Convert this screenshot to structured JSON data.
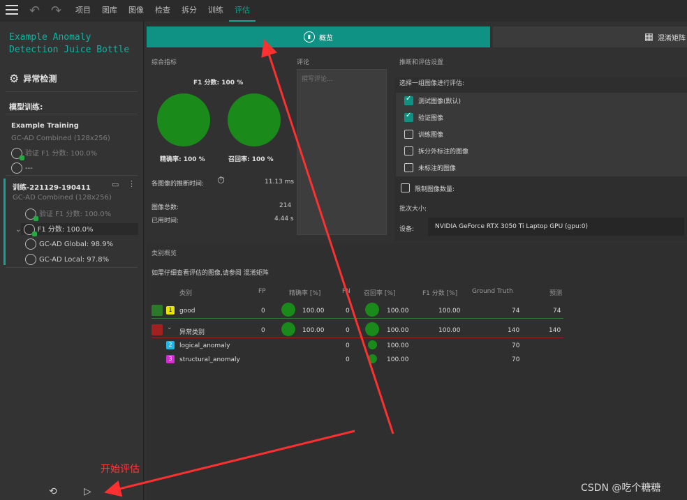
{
  "topbar": {
    "tabs": [
      {
        "label": "项目"
      },
      {
        "label": "图库"
      },
      {
        "label": "图像"
      },
      {
        "label": "检查"
      },
      {
        "label": "拆分"
      },
      {
        "label": "训练"
      },
      {
        "label": "评估",
        "active": true
      }
    ]
  },
  "sidebar": {
    "project_title": "Example Anomaly Detection Juice Bottle",
    "mode_label": "异常检测",
    "section_title": "模型训练:",
    "training_name": "Example Training",
    "training_model": "GC-AD Combined (128x256)",
    "training_f1": "验证 F1 分数: 100.0%",
    "training_dash": "---",
    "run_name": "训练-221129-190411",
    "run_model": "GC-AD Combined (128x256)",
    "run_val_f1": "验证 F1 分数: 100.0%",
    "run_f1": "F1 分数: 100.0%",
    "run_global": "GC-AD Global: 98.9%",
    "run_local": "GC-AD Local: 97.8%"
  },
  "main": {
    "tab_overview": "概览",
    "tab_confusion": "混淆矩阵",
    "summary_label": "综合指标",
    "f1_label": "F1 分数:  100 %",
    "precision_label": "精确率:  100 %",
    "recall_label": "召回率:  100 %",
    "infer_time_label": "各图像的推断时间:",
    "infer_time_value": "11.13 ms",
    "total_images_label": "图像总数:",
    "total_images_value": "214",
    "elapsed_label": "已用时间:",
    "elapsed_value": "4.44 s",
    "comment_label": "评论",
    "comment_placeholder": "撰写评论...",
    "settings_label": "推断和评估设置",
    "select_images_label": "选择一组图像进行评估:",
    "image_sets": [
      {
        "label": "测试图像(默认)",
        "checked": true
      },
      {
        "label": "验证图像",
        "checked": true
      },
      {
        "label": "训练图像",
        "checked": false
      },
      {
        "label": "拆分外标注的图像",
        "checked": false
      },
      {
        "label": "未标注的图像",
        "checked": false
      }
    ],
    "limit_label": "限制图像数量:",
    "batch_label": "批次大小:",
    "device_label": "设备:",
    "device_value": "NVIDIA GeForce RTX 3050 Ti Laptop GPU (gpu:0)",
    "class_overview_label": "类别概览",
    "class_hint": "如需仔细查看评估的图像,请参阅 混淆矩阵",
    "table_headers": {
      "category": "类别",
      "fp": "FP",
      "precision": "精确率 [%]",
      "fn": "FN",
      "recall": "召回率 [%]",
      "f1": "F1 分数 [%]",
      "gt": "Ground Truth",
      "pred": "预测"
    },
    "rows": [
      {
        "num": "1",
        "name": "good",
        "fp": "0",
        "precision": "100.00",
        "fn": "0",
        "recall": "100.00",
        "f1": "100.00",
        "gt": "74",
        "pred": "74"
      },
      {
        "name": "异常类别",
        "fp": "0",
        "precision": "100.00",
        "fn": "0",
        "recall": "100.00",
        "f1": "100.00",
        "gt": "140",
        "pred": "140"
      },
      {
        "num": "2",
        "name": "logical_anomaly",
        "fn": "0",
        "recall": "100.00",
        "gt": "70"
      },
      {
        "num": "3",
        "name": "structural_anomaly",
        "fn": "0",
        "recall": "100.00",
        "gt": "70"
      }
    ],
    "colors": {
      "accent": "#0f9184",
      "green": "#1a8a1a",
      "good_badge": "#e6e600",
      "anomaly2": "#1fb7e8",
      "anomaly3": "#d12fd1"
    }
  },
  "annotation_text": "开始评估",
  "watermark": "CSDN @吃个糖糖"
}
